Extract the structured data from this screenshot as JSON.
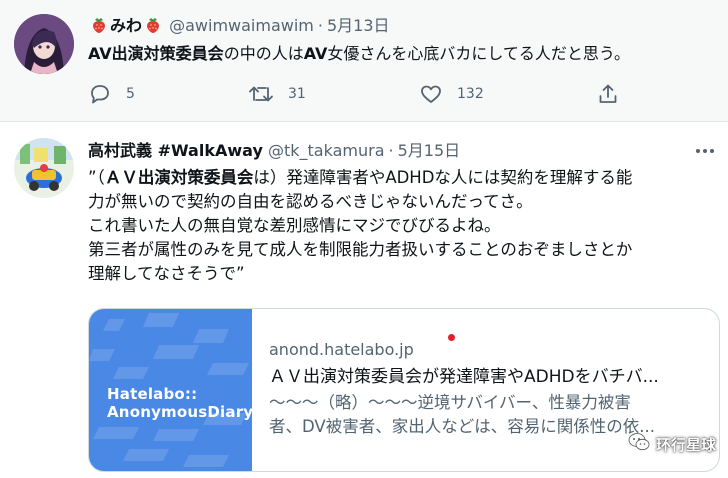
{
  "tweets": [
    {
      "display_name": "みわ",
      "handle": "@awimwaimawim",
      "separator": "·",
      "date": "5月13日",
      "text_bold_1": "AV出演対策委員会",
      "text_plain_1": "の中の人は",
      "text_bold_2": "AV",
      "text_plain_2": "女優さんを心底バカにしてる人だと思う。",
      "reply_count": "5",
      "retweet_count": "31",
      "like_count": "132"
    },
    {
      "display_name": "高村武義 #WalkAway",
      "handle": "@tk_takamura",
      "separator": "·",
      "date": "5月15日",
      "text_lines": [
        "”（ＡＶ出演対策委員会は）発達障害者やADHDな人には契約を理解する能",
        "力が無いので契約の自由を認めるべきじゃないんだってさ。",
        "これ書いた人の無自覚な差別感情にマジでびびるよね。",
        "第三者が属性のみを見て成人を制限能力者扱いすることのおぞましさとか",
        "理解してなさそうで”"
      ],
      "text_bold_segment": "ＡＶ出演対策委員会"
    }
  ],
  "card": {
    "thumbnail_line1": "Hatelabo::",
    "thumbnail_line2": "AnonymousDiary",
    "domain": "anond.hatelabo.jp",
    "title": "ＡＶ出演対策委員会が発達障害やADHDをバチバ...",
    "description_lines": [
      "～～～（略）～～～逆境サバイバー、性暴力被害",
      "者、DV被害者、家出人などは、容易に関係性の依..."
    ]
  },
  "watermark": {
    "text": "环行星球"
  },
  "colors": {
    "accent_blue": "#4a88e6",
    "secondary_text": "#536471",
    "primary_text": "#0f1419",
    "tweet1_background": "#f7f9f9",
    "red_dot": "#e0202a"
  },
  "icons": [
    "reply-icon",
    "retweet-icon",
    "like-icon",
    "share-icon",
    "more-icon",
    "strawberry-icon",
    "wechat-icon"
  ]
}
